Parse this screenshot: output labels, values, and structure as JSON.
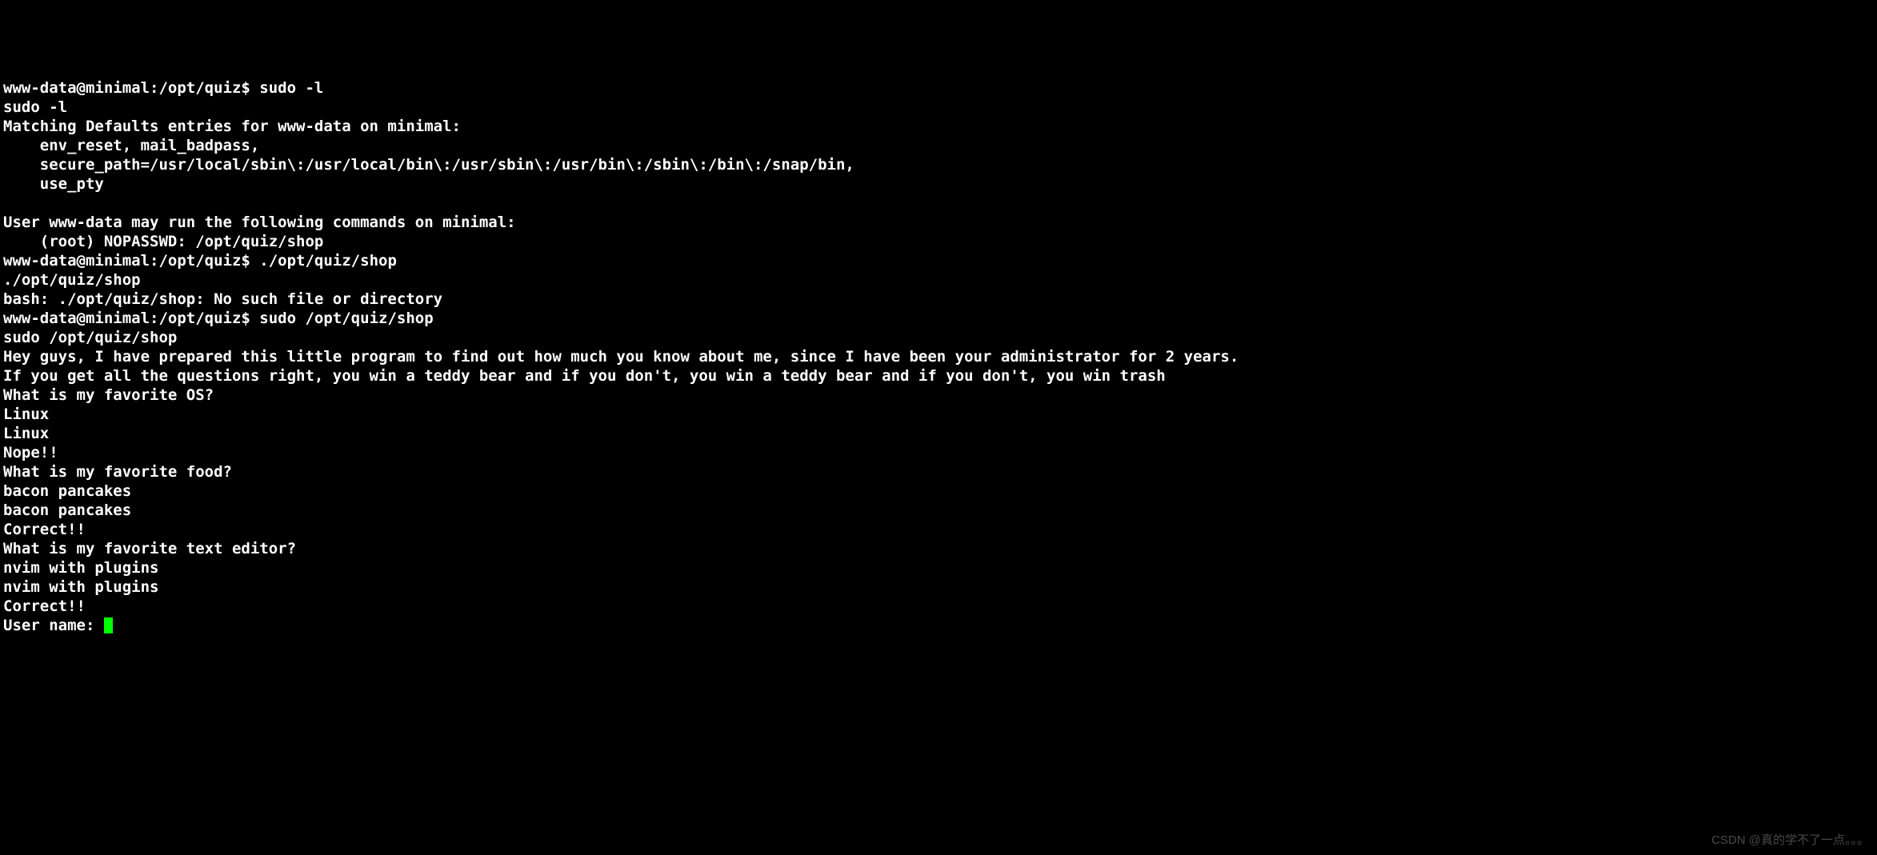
{
  "terminal": {
    "lines": [
      {
        "type": "prompt_cmd",
        "prompt": "www-data@minimal:/opt/quiz$ ",
        "cmd": "sudo -l"
      },
      {
        "type": "text",
        "text": "sudo -l"
      },
      {
        "type": "text",
        "text": "Matching Defaults entries for www-data on minimal:"
      },
      {
        "type": "text",
        "text": "    env_reset, mail_badpass,"
      },
      {
        "type": "text",
        "text": "    secure_path=/usr/local/sbin\\:/usr/local/bin\\:/usr/sbin\\:/usr/bin\\:/sbin\\:/bin\\:/snap/bin,"
      },
      {
        "type": "text",
        "text": "    use_pty"
      },
      {
        "type": "text",
        "text": ""
      },
      {
        "type": "text",
        "text": "User www-data may run the following commands on minimal:"
      },
      {
        "type": "text",
        "text": "    (root) NOPASSWD: /opt/quiz/shop"
      },
      {
        "type": "prompt_cmd",
        "prompt": "www-data@minimal:/opt/quiz$ ",
        "cmd": "./opt/quiz/shop"
      },
      {
        "type": "text",
        "text": "./opt/quiz/shop"
      },
      {
        "type": "text",
        "text": "bash: ./opt/quiz/shop: No such file or directory"
      },
      {
        "type": "prompt_cmd",
        "prompt": "www-data@minimal:/opt/quiz$ ",
        "cmd": "sudo /opt/quiz/shop"
      },
      {
        "type": "text",
        "text": "sudo /opt/quiz/shop"
      },
      {
        "type": "text",
        "text": "Hey guys, I have prepared this little program to find out how much you know about me, since I have been your administrator for 2 years."
      },
      {
        "type": "text",
        "text": "If you get all the questions right, you win a teddy bear and if you don't, you win a teddy bear and if you don't, you win trash"
      },
      {
        "type": "text",
        "text": "What is my favorite OS?"
      },
      {
        "type": "text",
        "text": "Linux"
      },
      {
        "type": "text",
        "text": "Linux"
      },
      {
        "type": "text",
        "text": "Nope!!"
      },
      {
        "type": "text",
        "text": "What is my favorite food?"
      },
      {
        "type": "text",
        "text": "bacon pancakes"
      },
      {
        "type": "text",
        "text": "bacon pancakes"
      },
      {
        "type": "text",
        "text": "Correct!!"
      },
      {
        "type": "text",
        "text": "What is my favorite text editor?"
      },
      {
        "type": "text",
        "text": "nvim with plugins"
      },
      {
        "type": "text",
        "text": "nvim with plugins"
      },
      {
        "type": "text",
        "text": "Correct!!"
      },
      {
        "type": "cursor_line",
        "text": "User name: "
      }
    ]
  },
  "watermark": "CSDN @真的学不了一点。。。"
}
